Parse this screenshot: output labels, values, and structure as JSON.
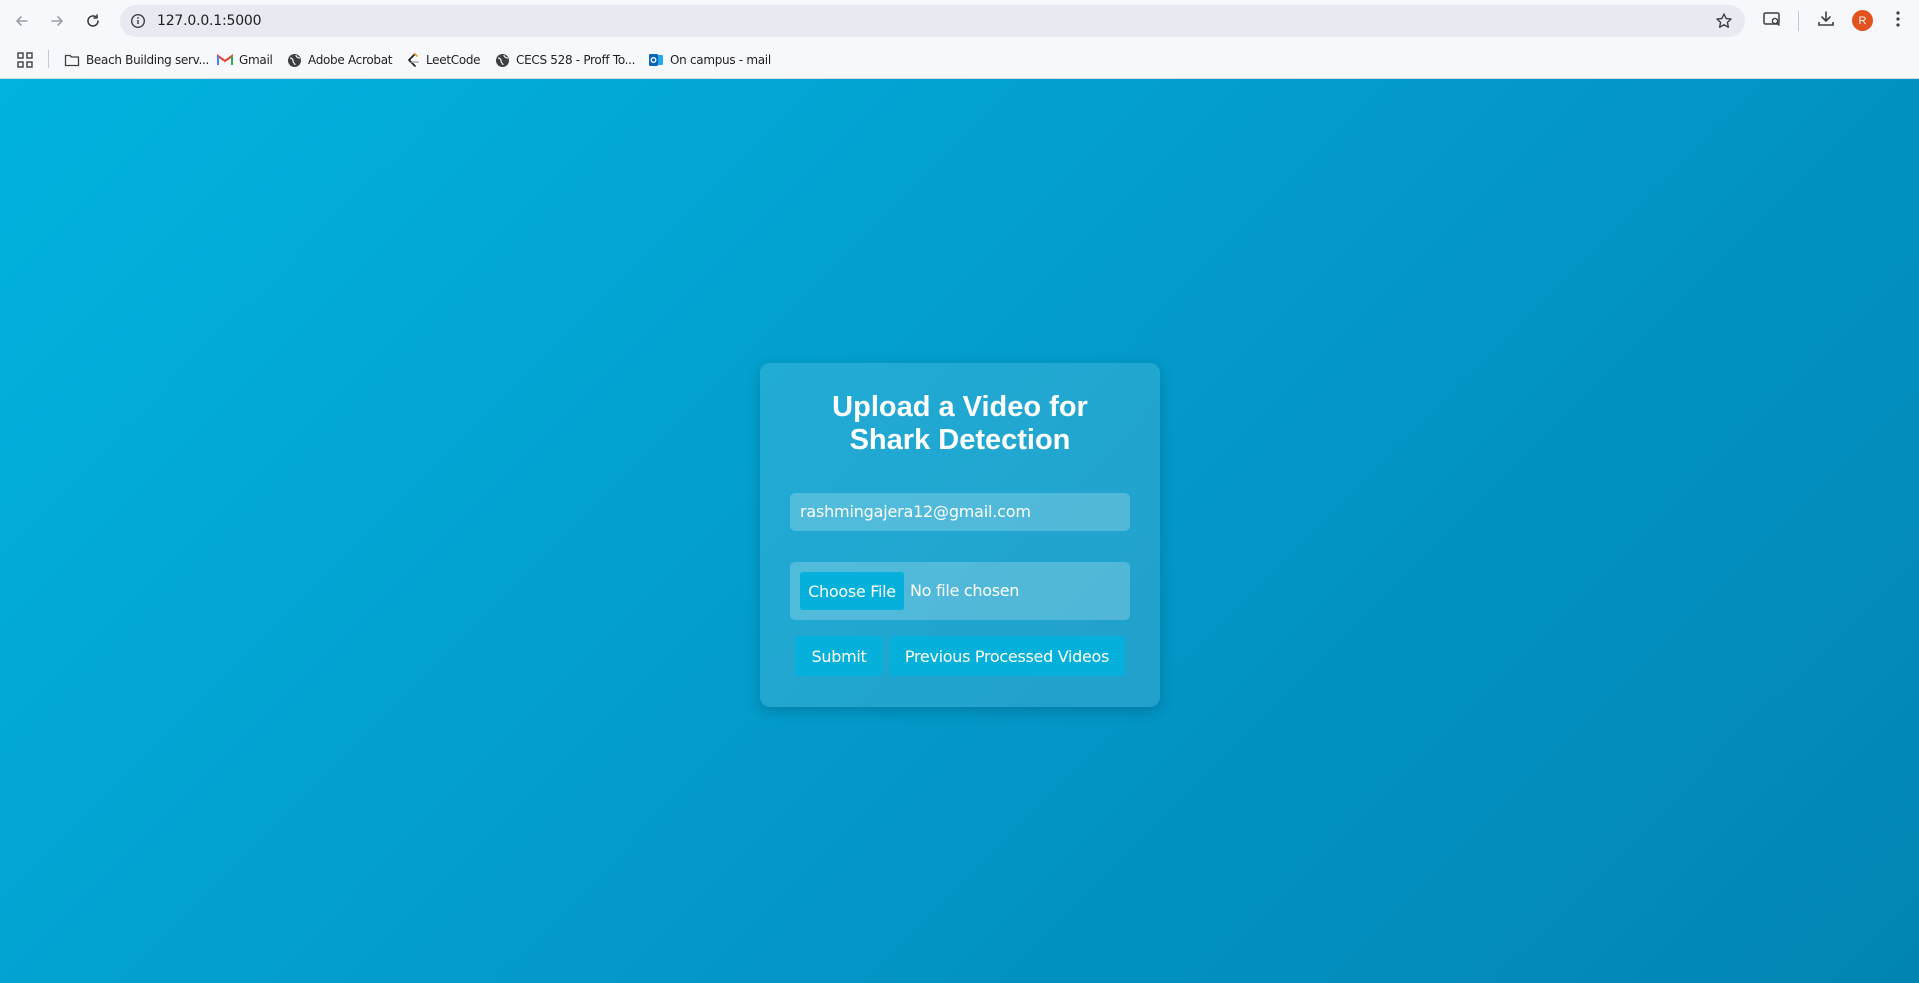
{
  "browser": {
    "url": "127.0.0.1:5000",
    "profile_initial": "R",
    "bookmarks": [
      {
        "label": "Beach Building serv...",
        "icon": "folder-icon"
      },
      {
        "label": "Gmail",
        "icon": "gmail-icon"
      },
      {
        "label": "Adobe Acrobat",
        "icon": "globe-icon"
      },
      {
        "label": "LeetCode",
        "icon": "leetcode-icon"
      },
      {
        "label": "CECS 528 - Proff To...",
        "icon": "globe-icon"
      },
      {
        "label": "On campus - mail",
        "icon": "outlook-icon"
      }
    ]
  },
  "form": {
    "title_line1": "Upload a Video for",
    "title_line2": "Shark Detection",
    "email_value": "rashmingajera12@gmail.com",
    "choose_file_label": "Choose File",
    "file_status": "No file chosen",
    "submit_label": "Submit",
    "previous_label": "Previous Processed Videos"
  },
  "colors": {
    "background_start": "#02b3df",
    "background_end": "#0184b4",
    "button": "#05b0da",
    "avatar": "#e2531f"
  }
}
